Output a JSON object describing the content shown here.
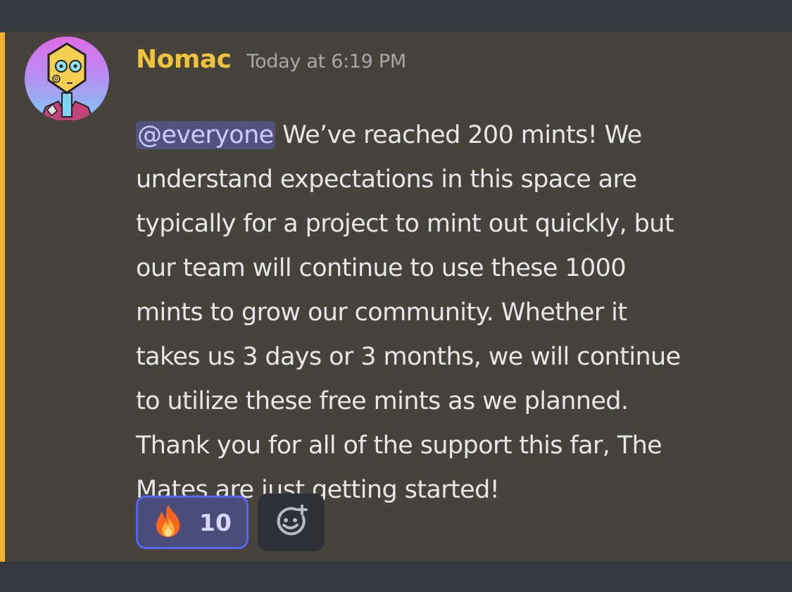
{
  "message": {
    "author": "Nomac",
    "timestamp": "Today at 6:19 PM",
    "mention": "@everyone",
    "lines": [
      " We’ve reached 200 mints! We",
      "understand expectations in this space are",
      "typically for a project to mint out quickly, but",
      "our team will continue to use these 1000",
      "mints to grow our community. Whether it",
      "takes us 3 days or 3 months, we will continue",
      "to utilize these free mints as we planned.",
      "Thank you for all of the support this far, The",
      "Mates are just getting started!"
    ]
  },
  "reactions": [
    {
      "emoji_icon": "fire-icon",
      "count": "10",
      "selected": true
    }
  ],
  "add_reaction_icon": "add-reaction-icon",
  "colors": {
    "username": "#f0c33c",
    "mention_bg": "#52527e",
    "mention_text": "#c9cdf8",
    "highlight_bar": "#f0b232",
    "message_bg": "#46433c",
    "reaction_border": "#5865f2"
  }
}
